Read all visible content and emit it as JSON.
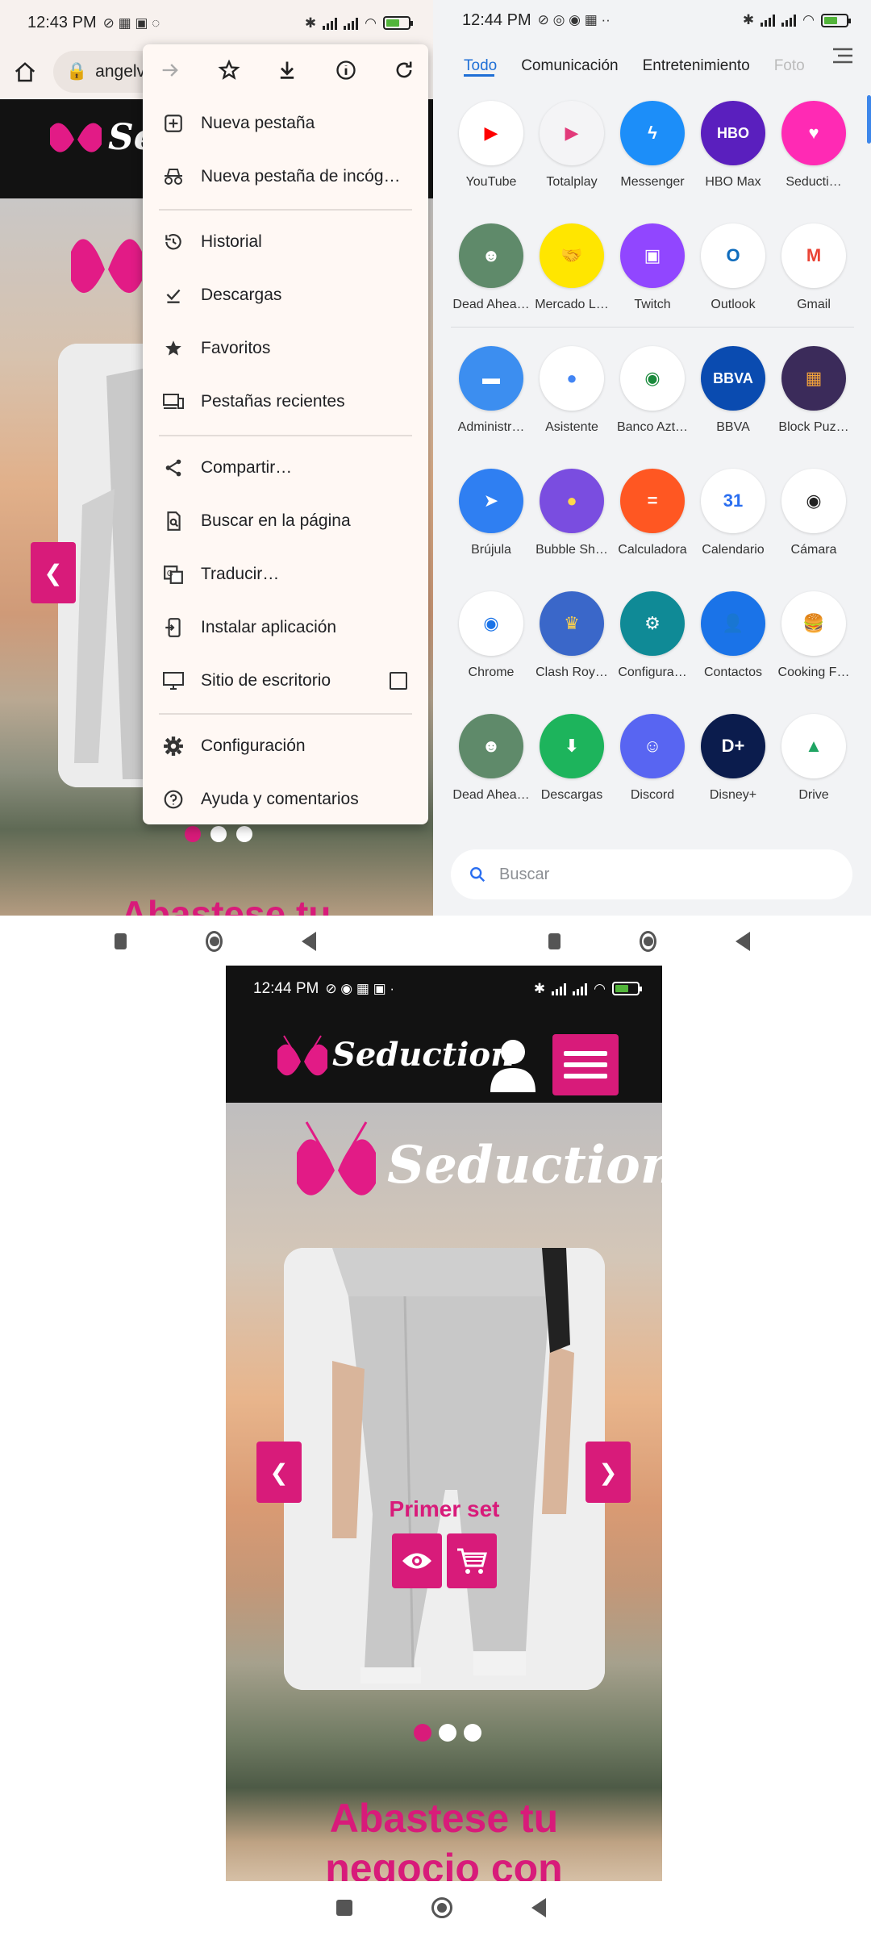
{
  "panel_a": {
    "status_time": "12:43 PM",
    "battery": "58",
    "url_text": "angelv",
    "brand_fragment": "Se",
    "menu": {
      "items": [
        {
          "label": "Nueva pestaña",
          "icon": "plus-box-icon"
        },
        {
          "label": "Nueva pestaña de incóg…",
          "icon": "incognito-icon"
        },
        {
          "label": "Historial",
          "icon": "history-icon"
        },
        {
          "label": "Descargas",
          "icon": "download-check-icon"
        },
        {
          "label": "Favoritos",
          "icon": "star-icon"
        },
        {
          "label": "Pestañas recientes",
          "icon": "devices-icon"
        },
        {
          "label": "Compartir…",
          "icon": "share-icon"
        },
        {
          "label": "Buscar en la página",
          "icon": "find-in-page-icon"
        },
        {
          "label": "Traducir…",
          "icon": "translate-icon"
        },
        {
          "label": "Instalar aplicación",
          "icon": "install-app-icon"
        },
        {
          "label": "Sitio de escritorio",
          "icon": "desktop-icon"
        },
        {
          "label": "Configuración",
          "icon": "gear-icon"
        },
        {
          "label": "Ayuda y comentarios",
          "icon": "help-icon"
        }
      ]
    },
    "bottom_text": "Abastese tu"
  },
  "panel_b": {
    "status_time": "12:44 PM",
    "battery": "58",
    "tabs": [
      "Todo",
      "Comunicación",
      "Entretenimiento",
      "Foto"
    ],
    "apps": [
      {
        "label": "YouTube",
        "color": "#ffffff",
        "glyph": "▶",
        "fg": "#ff0000"
      },
      {
        "label": "Totalplay",
        "color": "#f4f4f6",
        "glyph": "▶",
        "fg": "#e23a7a"
      },
      {
        "label": "Messenger",
        "color": "#1c8ef9",
        "glyph": "ϟ",
        "fg": "#ffffff"
      },
      {
        "label": "HBO Max",
        "color": "#5a1fbe",
        "glyph": "HBO",
        "fg": "#ffffff"
      },
      {
        "label": "Seducti…",
        "color": "#ff2ab4",
        "glyph": "♥",
        "fg": "#ffffff"
      },
      {
        "label": "Dead Ahea…",
        "color": "#5f8a6a",
        "glyph": "☻",
        "fg": "#ffffff"
      },
      {
        "label": "Mercado L…",
        "color": "#ffe600",
        "glyph": "🤝",
        "fg": "#2d3277"
      },
      {
        "label": "Twitch",
        "color": "#9146ff",
        "glyph": "▣",
        "fg": "#ffffff"
      },
      {
        "label": "Outlook",
        "color": "#ffffff",
        "glyph": "O",
        "fg": "#0f6cbd"
      },
      {
        "label": "Gmail",
        "color": "#ffffff",
        "glyph": "M",
        "fg": "#ea4335"
      },
      {
        "label": "Administr…",
        "color": "#3c8ef0",
        "glyph": "▬",
        "fg": "#ffffff"
      },
      {
        "label": "Asistente",
        "color": "#ffffff",
        "glyph": "●",
        "fg": "#4285f4"
      },
      {
        "label": "Banco Azt…",
        "color": "#ffffff",
        "glyph": "◉",
        "fg": "#1a8a3c"
      },
      {
        "label": "BBVA",
        "color": "#0a4bb0",
        "glyph": "BBVA",
        "fg": "#ffffff"
      },
      {
        "label": "Block Puz…",
        "color": "#3b2b5a",
        "glyph": "▦",
        "fg": "#f2a23a"
      },
      {
        "label": "Brújula",
        "color": "#2f7ff2",
        "glyph": "➤",
        "fg": "#ffffff"
      },
      {
        "label": "Bubble Sh…",
        "color": "#7a4de0",
        "glyph": "●",
        "fg": "#ffd84a"
      },
      {
        "label": "Calculadora",
        "color": "#ff5722",
        "glyph": "=",
        "fg": "#ffffff"
      },
      {
        "label": "Calendario",
        "color": "#ffffff",
        "glyph": "31",
        "fg": "#2a6ef0"
      },
      {
        "label": "Cámara",
        "color": "#ffffff",
        "glyph": "◉",
        "fg": "#222222"
      },
      {
        "label": "Chrome",
        "color": "#ffffff",
        "glyph": "◉",
        "fg": "#1a73e8"
      },
      {
        "label": "Clash Roy…",
        "color": "#3a67c9",
        "glyph": "♛",
        "fg": "#ffd24a"
      },
      {
        "label": "Configura…",
        "color": "#0f8a96",
        "glyph": "⚙",
        "fg": "#ffffff"
      },
      {
        "label": "Contactos",
        "color": "#1a73e8",
        "glyph": "👤",
        "fg": "#ffffff"
      },
      {
        "label": "Cooking F…",
        "color": "#ffffff",
        "glyph": "🍔",
        "fg": "#c0392b"
      },
      {
        "label": "Dead Ahea…",
        "color": "#5f8a6a",
        "glyph": "☻",
        "fg": "#ffffff"
      },
      {
        "label": "Descargas",
        "color": "#1db45c",
        "glyph": "⬇",
        "fg": "#ffffff"
      },
      {
        "label": "Discord",
        "color": "#5865f2",
        "glyph": "☺",
        "fg": "#ffffff"
      },
      {
        "label": "Disney+",
        "color": "#0b1c4d",
        "glyph": "D+",
        "fg": "#ffffff"
      },
      {
        "label": "Drive",
        "color": "#ffffff",
        "glyph": "▲",
        "fg": "#1fa463"
      }
    ],
    "search_placeholder": "Buscar"
  },
  "panel_c": {
    "status_time": "12:44 PM",
    "battery": "58",
    "brand": "Seduction",
    "card_title": "Primer set",
    "headline_1": "Abastese tu",
    "headline_2": "negocio con"
  },
  "colors": {
    "accent": "#d81b7a",
    "drawer_tab_active": "#1f6fd6",
    "header_bg": "#121212"
  }
}
